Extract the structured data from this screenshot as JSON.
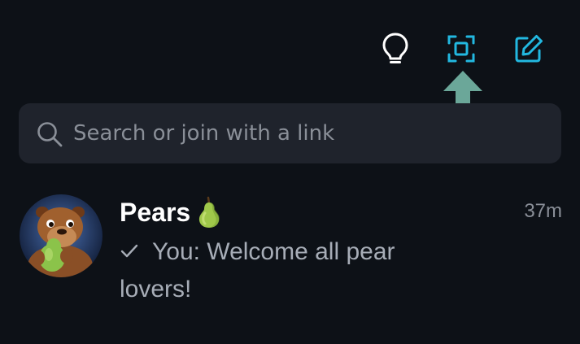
{
  "toolbar": {
    "tips_icon": "lightbulb-icon",
    "scan_icon": "qr-scan-icon",
    "compose_icon": "compose-icon",
    "accent_color": "#22b8e0"
  },
  "annotation": {
    "icon": "arrow-up-icon",
    "color": "#6ba799"
  },
  "search": {
    "placeholder": "Search or join with a link",
    "value": ""
  },
  "chats": [
    {
      "name": "Pears",
      "emoji": "pear-icon",
      "time": "37m",
      "status_icon": "check-icon",
      "preview": "You: Welcome all pear lovers!",
      "avatar": "capybara-with-pear-avatar"
    }
  ]
}
